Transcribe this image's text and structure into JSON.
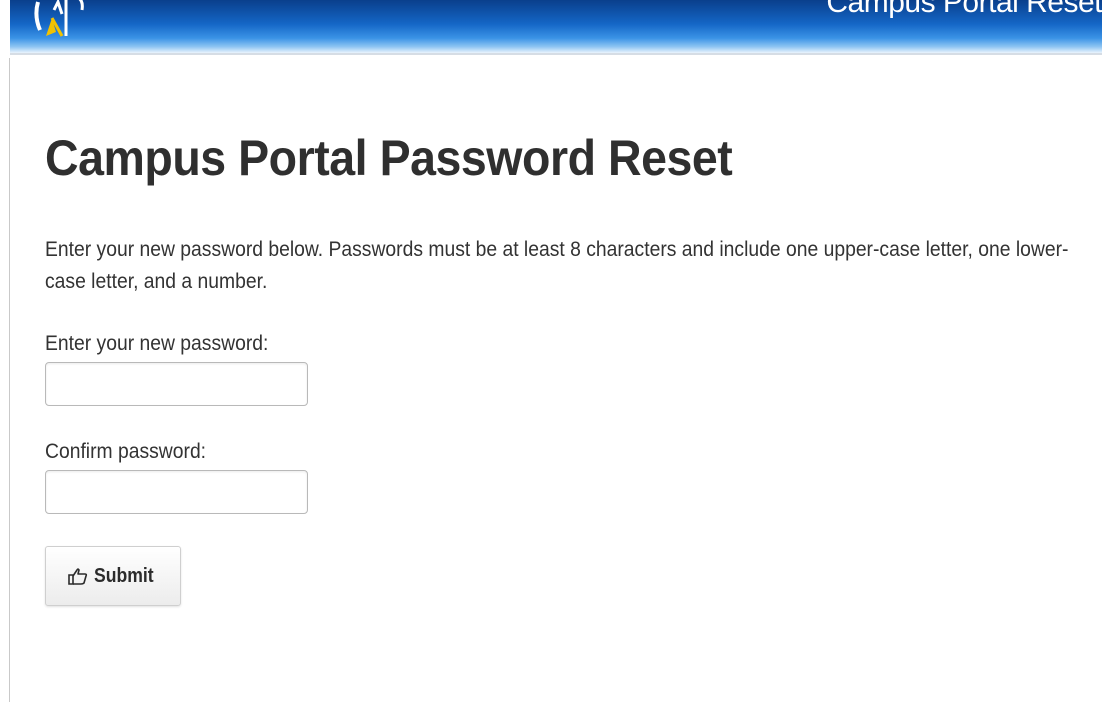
{
  "header": {
    "title": "Campus Portal Reset",
    "logo_icon": "campus-logo-icon"
  },
  "main": {
    "title": "Campus Portal Password Reset",
    "instructions": "Enter your new password below. Passwords must be at least 8 characters and include one upper-case letter, one lower-case letter, and a number."
  },
  "form": {
    "new_password_label": "Enter your new password:",
    "new_password_value": "",
    "confirm_password_label": "Confirm password:",
    "confirm_password_value": "",
    "submit_label": "Submit",
    "submit_icon": "hand-pointer-icon"
  },
  "colors": {
    "header_dark": "#0a3f8c",
    "header_light": "#8dc4f2",
    "logo_accent": "#f2c200"
  }
}
